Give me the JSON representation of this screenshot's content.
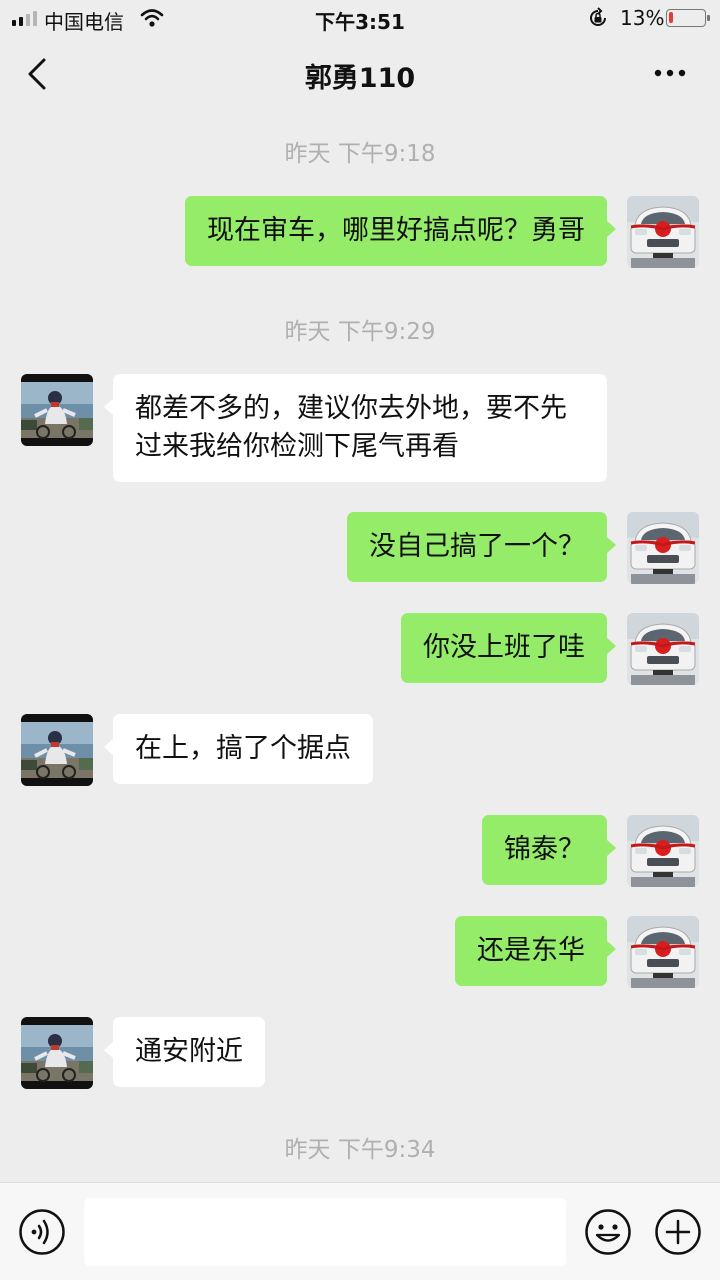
{
  "status_bar": {
    "carrier": "中国电信",
    "time": "下午3:51",
    "battery_percent_text": "13%",
    "battery_level": 0.13,
    "battery_color": "#e33c3c"
  },
  "nav": {
    "title": "郭勇110",
    "back_icon": "chevron-left-icon",
    "more_icon": "ellipsis-icon"
  },
  "messages": [
    {
      "type": "timestamp",
      "text": "昨天 下午9:18"
    },
    {
      "type": "message",
      "side": "out",
      "text": "现在审车，哪里好搞点呢？勇哥"
    },
    {
      "type": "timestamp",
      "text": "昨天 下午9:29"
    },
    {
      "type": "message",
      "side": "in",
      "text": "都差不多的，建议你去外地，要不先过来我给你检测下尾气再看"
    },
    {
      "type": "message",
      "side": "out",
      "text": "没自己搞了一个？"
    },
    {
      "type": "message",
      "side": "out",
      "text": "你没上班了哇"
    },
    {
      "type": "message",
      "side": "in",
      "text": "在上，搞了个据点"
    },
    {
      "type": "message",
      "side": "out",
      "text": "锦泰？"
    },
    {
      "type": "message",
      "side": "out",
      "text": "还是东华"
    },
    {
      "type": "message",
      "side": "in",
      "text": "通安附近"
    },
    {
      "type": "timestamp",
      "text": "昨天 下午9:34"
    }
  ],
  "input_bar": {
    "value": "",
    "voice_icon": "voice-icon",
    "emoji_icon": "emoji-icon",
    "plus_icon": "plus-icon"
  },
  "colors": {
    "outgoing_bubble": "#95ec69",
    "incoming_bubble": "#ffffff",
    "background": "#ededed"
  }
}
